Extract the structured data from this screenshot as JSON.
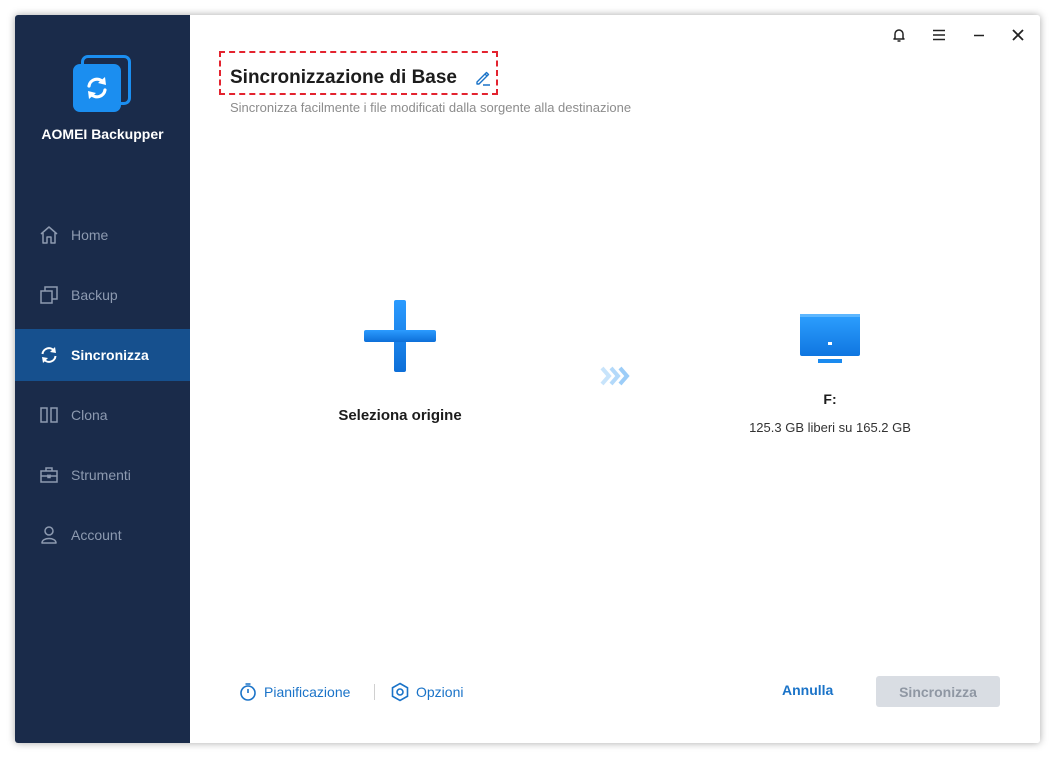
{
  "app": {
    "name": "AOMEI Backupper"
  },
  "sidebar": {
    "items": [
      {
        "label": "Home",
        "icon": "home-icon",
        "active": false
      },
      {
        "label": "Backup",
        "icon": "copy-icon",
        "active": false
      },
      {
        "label": "Sincronizza",
        "icon": "sync-icon",
        "active": true
      },
      {
        "label": "Clona",
        "icon": "clone-icon",
        "active": false
      },
      {
        "label": "Strumenti",
        "icon": "toolbox-icon",
        "active": false
      },
      {
        "label": "Account",
        "icon": "user-icon",
        "active": false
      }
    ]
  },
  "header": {
    "title": "Sincronizzazione di Base",
    "subtitle": "Sincronizza facilmente i file modificati dalla sorgente alla destinazione"
  },
  "source": {
    "label": "Seleziona origine"
  },
  "destination": {
    "label": "F:",
    "info": "125.3 GB liberi su 165.2 GB"
  },
  "footer": {
    "schedule_label": "Pianificazione",
    "options_label": "Opzioni",
    "cancel_label": "Annulla",
    "sync_label": "Sincronizza"
  },
  "colors": {
    "sidebar_bg": "#1a2b4a",
    "active_bg": "#16508e",
    "accent": "#1b8ef0",
    "link": "#1a73c8",
    "highlight_border": "#e3232f"
  }
}
